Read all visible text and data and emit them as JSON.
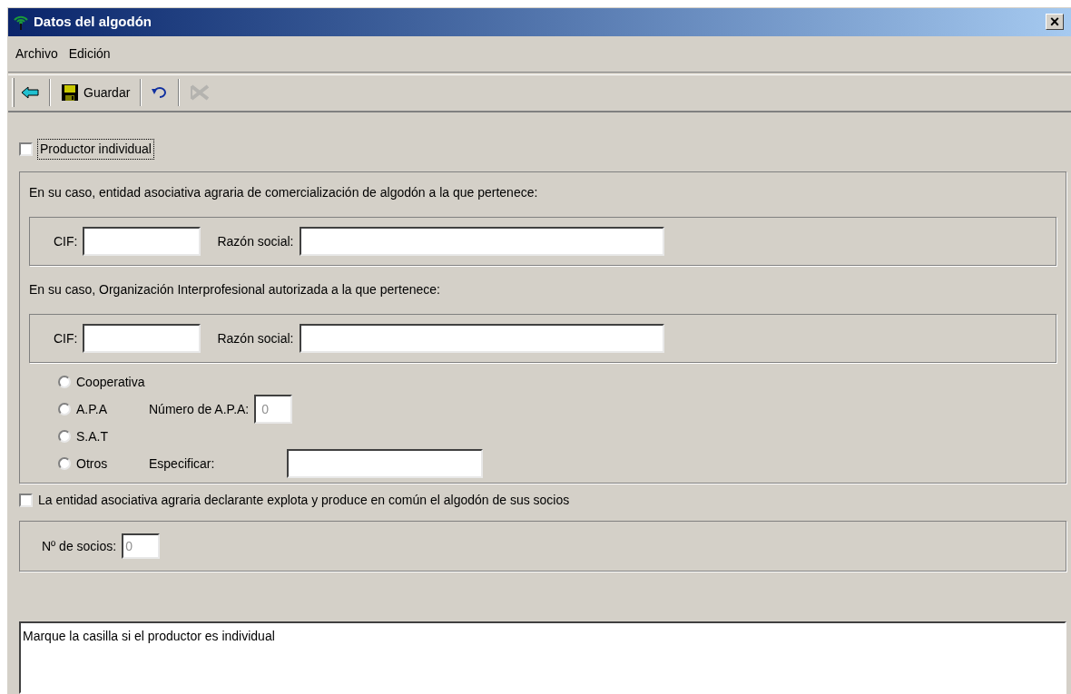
{
  "window": {
    "title": "Datos del algodón",
    "close": "×"
  },
  "menu": [
    "Archivo",
    "Edición"
  ],
  "toolbar": [
    {
      "kind": "back",
      "disabled": false
    },
    {
      "kind": "save",
      "label": "Guardar",
      "disabled": false
    },
    {
      "kind": "undo",
      "disabled": false
    },
    {
      "kind": "delete",
      "disabled": true
    }
  ],
  "individual": {
    "label": "Productor individual",
    "checked": false,
    "focused": true
  },
  "entity_section": {
    "title": "En su caso, entidad asociativa agraria de comercialización de algodón a la que pertenece:",
    "cif_label": "CIF:",
    "name_label": "Razón social:"
  },
  "org_section": {
    "title": "En su caso, Organización Interprofesional autorizada a la que pertenece:",
    "cif_label": "CIF:",
    "name_label": "Razón social:"
  },
  "types": [
    {
      "label": "Cooperativa",
      "selected": false
    },
    {
      "label": "A.P.A",
      "selected": false,
      "field_label": "Número de A.P.A:",
      "field_value": "0"
    },
    {
      "label": "S.A.T",
      "selected": false
    },
    {
      "label": "Otros",
      "selected": false,
      "field_label": "Especificar:"
    }
  ],
  "common": {
    "label": "La entidad asociativa agraria declarante explota y produce en común el algodón de sus socios",
    "checked": false
  },
  "members": {
    "label": "Nº de socios:",
    "value": "0"
  },
  "help": "Marque la casilla si el productor es individual"
}
